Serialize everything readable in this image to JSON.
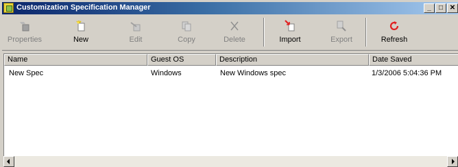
{
  "window": {
    "title": "Customization Specification Manager",
    "minimize_glyph": "_",
    "maximize_glyph": "□",
    "close_glyph": "✕"
  },
  "toolbar": {
    "properties": {
      "label": "Properties",
      "enabled": false,
      "icon": "properties-icon"
    },
    "new": {
      "label": "New",
      "enabled": true,
      "icon": "new-document-icon"
    },
    "edit": {
      "label": "Edit",
      "enabled": false,
      "icon": "edit-icon"
    },
    "copy": {
      "label": "Copy",
      "enabled": false,
      "icon": "copy-icon"
    },
    "delete": {
      "label": "Delete",
      "enabled": false,
      "icon": "delete-icon"
    },
    "import": {
      "label": "Import",
      "enabled": true,
      "icon": "import-icon"
    },
    "export": {
      "label": "Export",
      "enabled": false,
      "icon": "export-icon"
    },
    "refresh": {
      "label": "Refresh",
      "enabled": true,
      "icon": "refresh-icon"
    }
  },
  "table": {
    "columns": [
      "Name",
      "Guest OS",
      "Description",
      "Date Saved"
    ],
    "rows": [
      [
        "New Spec",
        "Windows",
        "New Windows spec",
        "1/3/2006 5:04:36 PM"
      ]
    ]
  },
  "colors": {
    "title_gradient_start": "#0a246a",
    "title_gradient_end": "#a6caf0",
    "chrome": "#d4d0c8",
    "refresh_red": "#e02020"
  }
}
